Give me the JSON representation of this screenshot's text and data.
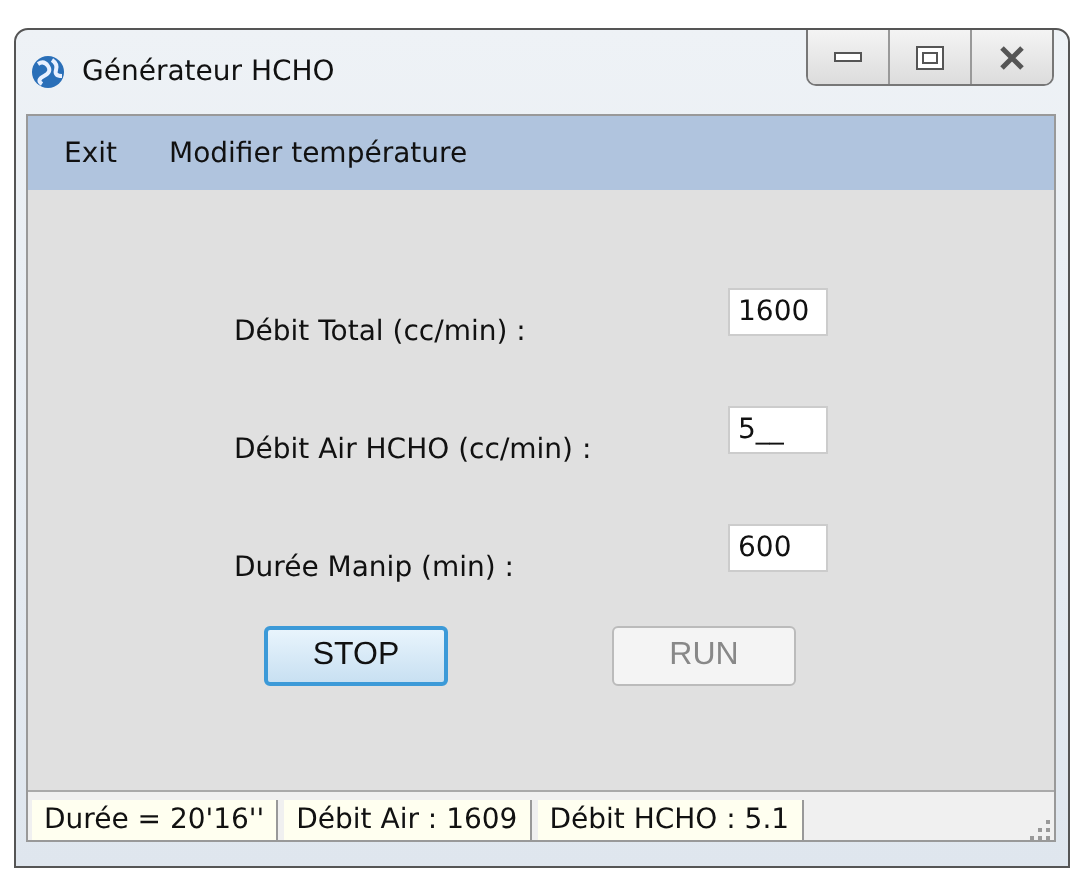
{
  "window": {
    "title": "Générateur HCHO"
  },
  "menu": [
    "Exit",
    "Modifier température"
  ],
  "fields": [
    {
      "label": "Débit Total (cc/min) :",
      "value": "1600"
    },
    {
      "label": "Débit Air HCHO (cc/min) :",
      "value": "5__"
    },
    {
      "label": "Durée Manip (min) :",
      "value": "600"
    }
  ],
  "buttons": [
    {
      "label": "STOP",
      "focused": true,
      "disabled": false
    },
    {
      "label": "RUN",
      "focused": false,
      "disabled": true
    }
  ],
  "status_bar": [
    "Durée = 20'16''",
    "Débit Air : 1609",
    "Débit HCHO : 5.1"
  ]
}
